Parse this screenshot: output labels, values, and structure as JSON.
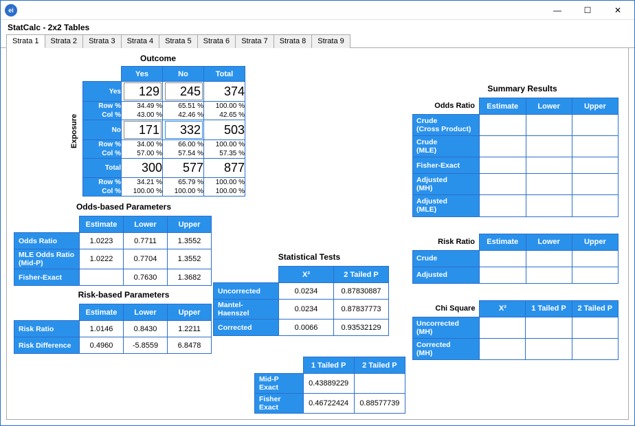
{
  "window": {
    "app_icon_text": "ei",
    "min": "—",
    "max": "☐",
    "close": "✕"
  },
  "app_title": "StatCalc - 2x2 Tables",
  "tabs": [
    "Strata 1",
    "Strata 2",
    "Strata 3",
    "Strata 4",
    "Strata 5",
    "Strata 6",
    "Strata 7",
    "Strata 8",
    "Strata 9"
  ],
  "active_tab": 0,
  "outcome": {
    "title": "Outcome",
    "exposure_label": "Exposure",
    "cols": {
      "yes": "Yes",
      "no": "No",
      "total": "Total"
    },
    "row_yes": "Yes",
    "row_no": "No",
    "row_total": "Total",
    "row_pct_lbl": "Row %",
    "col_pct_lbl": "Col %",
    "cells": {
      "yy": "129",
      "yn": "245",
      "yt": "374",
      "yy_row": "34.49 %",
      "yn_row": "65.51 %",
      "yt_row": "100.00 %",
      "yy_col": "43.00 %",
      "yn_col": "42.46 %",
      "yt_col": "42.65 %",
      "ny": "171",
      "nn": "332",
      "nt": "503",
      "ny_row": "34.00 %",
      "nn_row": "66.00 %",
      "nt_row": "100.00 %",
      "ny_col": "57.00 %",
      "nn_col": "57.54 %",
      "nt_col": "57.35 %",
      "ty": "300",
      "tn": "577",
      "tt": "877",
      "ty_row": "34.21 %",
      "tn_row": "65.79 %",
      "tt_row": "100.00 %",
      "ty_col": "100.00 %",
      "tn_col": "100.00 %",
      "tt_col": "100.00 %"
    }
  },
  "odds_params": {
    "title": "Odds-based Parameters",
    "cols": {
      "est": "Estimate",
      "low": "Lower",
      "up": "Upper"
    },
    "rows": [
      {
        "lbl": "Odds Ratio",
        "est": "1.0223",
        "low": "0.7711",
        "up": "1.3552"
      },
      {
        "lbl": "MLE Odds Ratio (Mid-P)",
        "est": "1.0222",
        "low": "0.7704",
        "up": "1.3552"
      },
      {
        "lbl": "Fisher-Exact",
        "est": "",
        "low": "0.7630",
        "up": "1.3682"
      }
    ]
  },
  "risk_params": {
    "title": "Risk-based Parameters",
    "cols": {
      "est": "Estimate",
      "low": "Lower",
      "up": "Upper"
    },
    "rows": [
      {
        "lbl": "Risk Ratio",
        "est": "1.0146",
        "low": "0.8430",
        "up": "1.2211"
      },
      {
        "lbl": "Risk Difference",
        "est": "0.4960",
        "low": "-5.8559",
        "up": "6.8478"
      }
    ]
  },
  "stat_tests": {
    "title": "Statistical Tests",
    "cols": {
      "x2": "X²",
      "p2": "2 Tailed P"
    },
    "rows": [
      {
        "lbl": "Uncorrected",
        "x2": "0.0234",
        "p2": "0.87830887"
      },
      {
        "lbl": "Mantel-Haenszel",
        "x2": "0.0234",
        "p2": "0.87837773"
      },
      {
        "lbl": "Corrected",
        "x2": "0.0066",
        "p2": "0.93532129"
      }
    ]
  },
  "exact_tests": {
    "cols": {
      "p1": "1 Tailed P",
      "p2": "2 Tailed P"
    },
    "rows": [
      {
        "lbl": "Mid-P Exact",
        "p1": "0.43889229",
        "p2": ""
      },
      {
        "lbl": "Fisher Exact",
        "p1": "0.46722424",
        "p2": "0.88577739"
      }
    ]
  },
  "summary": {
    "title": "Summary Results",
    "odds_ratio_lbl": "Odds Ratio",
    "risk_ratio_lbl": "Risk Ratio",
    "chi_lbl": "Chi Square",
    "cols": {
      "est": "Estimate",
      "low": "Lower",
      "up": "Upper"
    },
    "chi_cols": {
      "x2": "X²",
      "p1": "1 Tailed P",
      "p2": "2 Tailed P"
    },
    "odds_rows": [
      "Crude (Cross Product)",
      "Crude (MLE)",
      "Fisher-Exact",
      "Adjusted (MH)",
      "Adjusted (MLE)"
    ],
    "risk_rows": [
      "Crude",
      "Adjusted"
    ],
    "chi_rows": [
      "Uncorrected (MH)",
      "Corrected (MH)"
    ]
  },
  "chart_data": {
    "type": "table",
    "title": "2x2 Exposure × Outcome",
    "categories": [
      "Yes",
      "No"
    ],
    "series": [
      {
        "name": "Exposure Yes",
        "values": [
          129,
          245
        ]
      },
      {
        "name": "Exposure No",
        "values": [
          171,
          332
        ]
      }
    ],
    "row_totals": [
      374,
      503
    ],
    "col_totals": [
      300,
      577
    ],
    "grand_total": 877
  }
}
